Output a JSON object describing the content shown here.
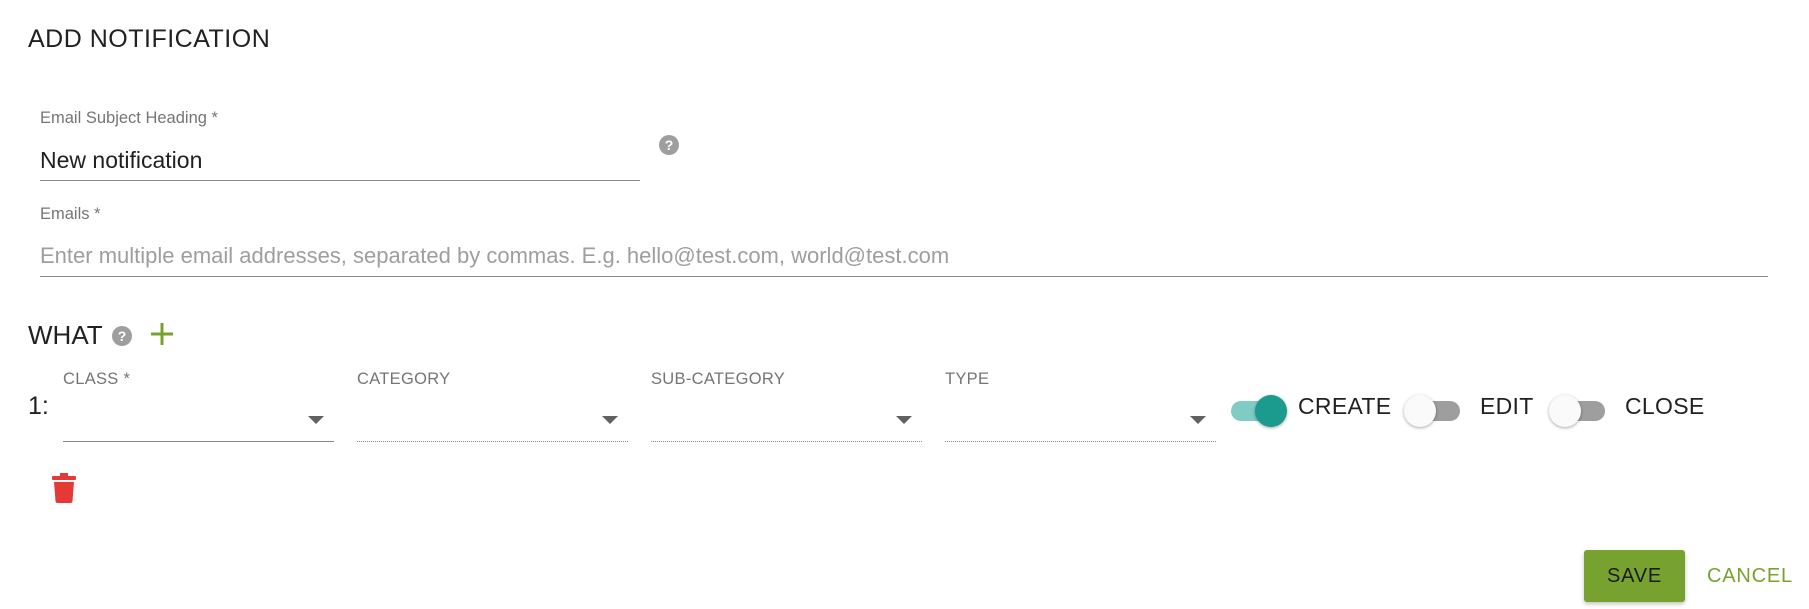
{
  "page": {
    "title": "ADD NOTIFICATION"
  },
  "subject": {
    "label": "Email Subject Heading *",
    "value": "New notification",
    "help_icon": "help-circle-icon"
  },
  "emails": {
    "label": "Emails *",
    "value": "",
    "placeholder": "Enter multiple email addresses, separated by commas. E.g. hello@test.com, world@test.com"
  },
  "what": {
    "label": "WHAT",
    "help_icon": "help-circle-icon",
    "add_icon": "plus-icon",
    "rows": [
      {
        "index": "1:",
        "class": {
          "label": "CLASS *",
          "value": ""
        },
        "category": {
          "label": "CATEGORY",
          "value": ""
        },
        "sub_category": {
          "label": "SUB-CATEGORY",
          "value": ""
        },
        "type": {
          "label": "TYPE",
          "value": ""
        },
        "toggles": [
          {
            "label": "CREATE",
            "on": true
          },
          {
            "label": "EDIT",
            "on": false
          },
          {
            "label": "CLOSE",
            "on": false
          }
        ],
        "delete_icon": "trash-icon"
      }
    ]
  },
  "actions": {
    "save_label": "SAVE",
    "cancel_label": "CANCEL"
  },
  "colors": {
    "accent_green": "#78a22f",
    "toggle_on": "#1a9b8e",
    "delete_red": "#e53935"
  }
}
